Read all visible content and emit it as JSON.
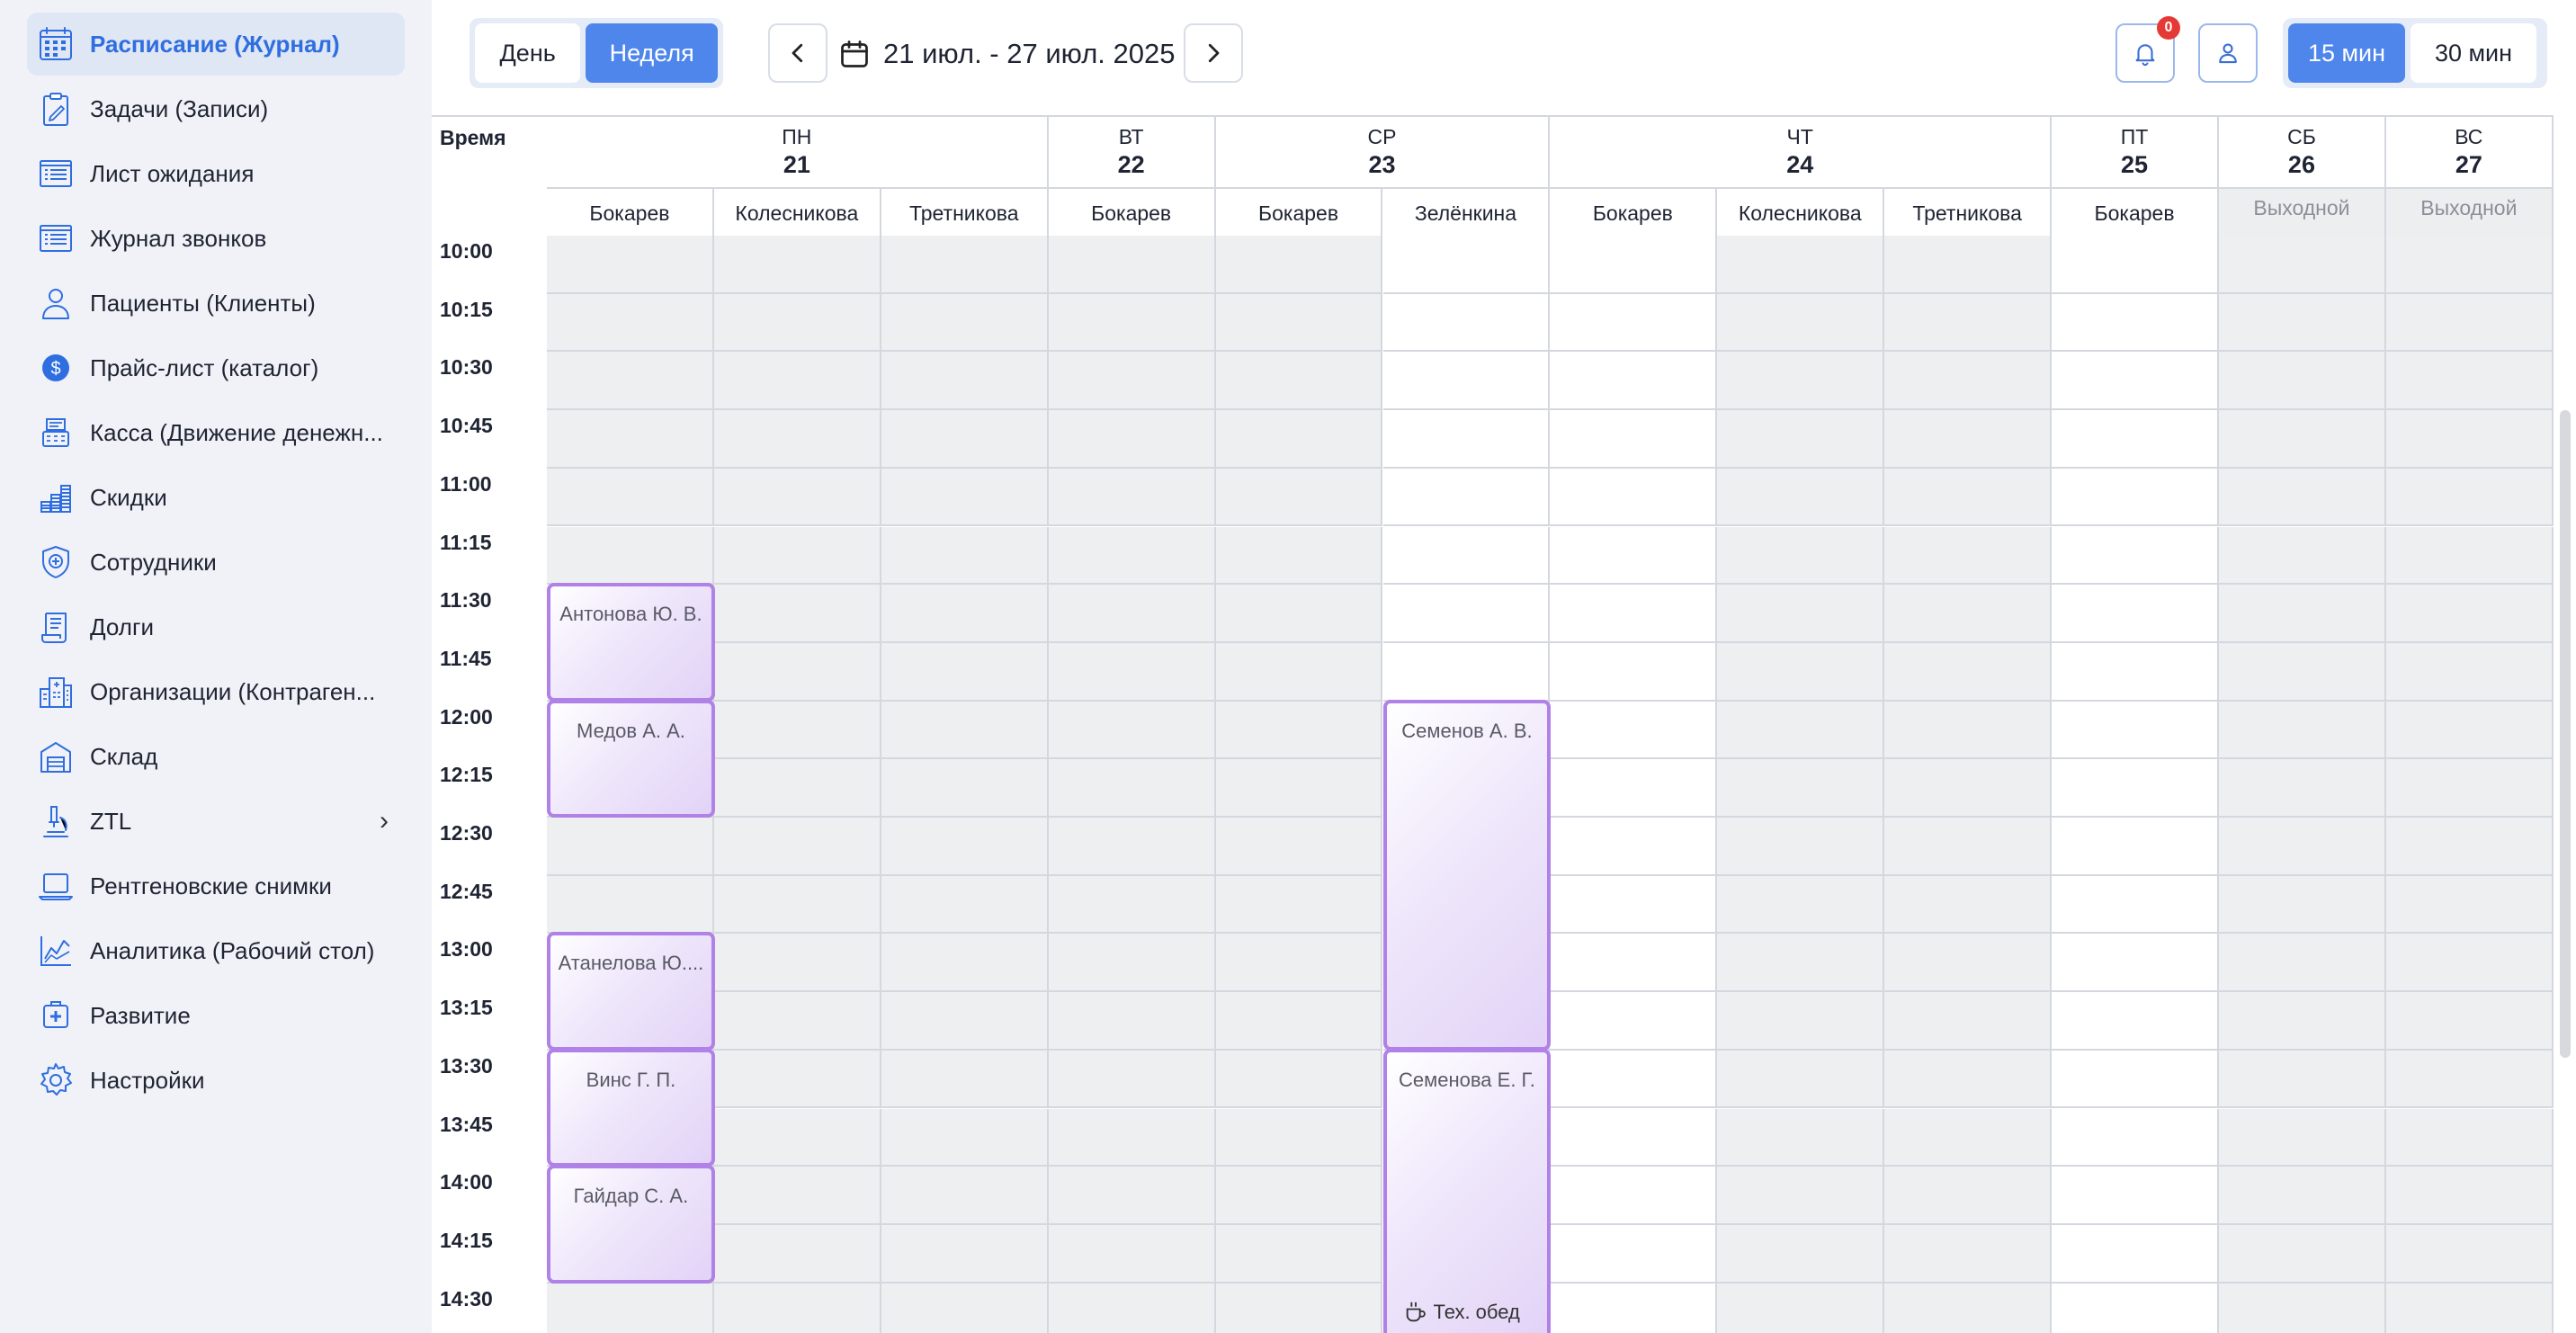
{
  "sidebar": {
    "items": [
      {
        "label": "Расписание (Журнал)",
        "icon": "calendar-grid-icon",
        "active": true
      },
      {
        "label": "Задачи (Записи)",
        "icon": "clipboard-pencil-icon"
      },
      {
        "label": "Лист ожидания",
        "icon": "list-icon"
      },
      {
        "label": "Журнал звонков",
        "icon": "list-icon"
      },
      {
        "label": "Пациенты (Клиенты)",
        "icon": "person-icon"
      },
      {
        "label": "Прайс-лист (каталог)",
        "icon": "dollar-coin-icon"
      },
      {
        "label": "Касса (Движение денежн...",
        "icon": "cash-register-icon"
      },
      {
        "label": "Скидки",
        "icon": "coins-stack-icon"
      },
      {
        "label": "Сотрудники",
        "icon": "shield-plus-icon"
      },
      {
        "label": "Долги",
        "icon": "scroll-icon"
      },
      {
        "label": "Организации (Контраген...",
        "icon": "building-icon"
      },
      {
        "label": "Склад",
        "icon": "warehouse-icon"
      },
      {
        "label": "ZTL",
        "icon": "microscope-icon",
        "has_children": true
      },
      {
        "label": "Рентгеновские снимки",
        "icon": "laptop-icon"
      },
      {
        "label": "Аналитика (Рабочий стол)",
        "icon": "chart-line-icon"
      },
      {
        "label": "Развитие",
        "icon": "medical-plus-icon"
      },
      {
        "label": "Настройки",
        "icon": "gear-icon"
      }
    ]
  },
  "toolbar": {
    "view_day": "День",
    "view_week": "Неделя",
    "date_range": "21 июл. - 27 июл. 2025",
    "notification_count": "0",
    "step_15": "15 мин",
    "step_30": "30 мин",
    "prev_icon": "chevron-left-icon",
    "next_icon": "chevron-right-icon"
  },
  "calendar": {
    "time_header": "Время",
    "days": [
      {
        "dow": "ПН",
        "date": "21",
        "doctors": [
          "Бокарев",
          "Колесникова",
          "Третникова"
        ]
      },
      {
        "dow": "ВТ",
        "date": "22",
        "doctors": [
          "Бокарев"
        ]
      },
      {
        "dow": "СР",
        "date": "23",
        "doctors": [
          "Бокарев",
          "Зелёнкина"
        ]
      },
      {
        "dow": "ЧТ",
        "date": "24",
        "doctors": [
          "Бокарев",
          "Колесникова",
          "Третникова"
        ]
      },
      {
        "dow": "ПТ",
        "date": "25",
        "doctors": [
          "Бокарев"
        ]
      },
      {
        "dow": "СБ",
        "date": "26",
        "doctors": [
          "Выходной"
        ],
        "day_off": true
      },
      {
        "dow": "ВС",
        "date": "27",
        "doctors": [
          "Выходной"
        ],
        "day_off": true
      }
    ],
    "times": [
      "10:00",
      "10:15",
      "10:30",
      "10:45",
      "11:00",
      "11:15",
      "11:30",
      "11:45",
      "12:00",
      "12:15",
      "12:30",
      "12:45",
      "13:00",
      "13:15",
      "13:30",
      "13:45",
      "14:00",
      "14:15",
      "14:30"
    ],
    "column_working": [
      [
        0,
        0,
        0,
        0,
        0,
        0,
        1,
        1,
        1,
        1,
        0,
        0,
        1,
        1,
        1,
        1,
        1,
        1,
        0
      ],
      [
        0,
        0,
        0,
        0,
        0,
        0,
        0,
        0,
        0,
        0,
        0,
        0,
        0,
        0,
        0,
        0,
        0,
        0,
        0
      ],
      [
        0,
        0,
        0,
        0,
        0,
        0,
        0,
        0,
        0,
        0,
        0,
        0,
        0,
        0,
        0,
        0,
        0,
        0,
        0
      ],
      [
        0,
        0,
        0,
        0,
        0,
        0,
        0,
        0,
        0,
        0,
        0,
        0,
        0,
        0,
        0,
        0,
        0,
        0,
        0
      ],
      [
        0,
        0,
        0,
        0,
        0,
        0,
        0,
        0,
        0,
        0,
        0,
        0,
        0,
        0,
        0,
        0,
        0,
        0,
        0
      ],
      [
        1,
        1,
        1,
        1,
        1,
        1,
        1,
        1,
        1,
        1,
        1,
        1,
        1,
        1,
        1,
        1,
        1,
        1,
        1
      ],
      [
        1,
        1,
        1,
        1,
        1,
        1,
        1,
        1,
        1,
        1,
        1,
        1,
        1,
        1,
        1,
        1,
        1,
        1,
        1
      ],
      [
        0,
        0,
        0,
        0,
        0,
        0,
        0,
        0,
        0,
        0,
        0,
        0,
        0,
        0,
        0,
        0,
        0,
        0,
        0
      ],
      [
        0,
        0,
        0,
        0,
        0,
        0,
        0,
        0,
        0,
        0,
        0,
        0,
        0,
        0,
        0,
        0,
        0,
        0,
        0
      ],
      [
        1,
        1,
        1,
        1,
        1,
        1,
        1,
        1,
        1,
        1,
        1,
        1,
        1,
        1,
        1,
        1,
        1,
        1,
        1
      ],
      [
        0,
        0,
        0,
        0,
        0,
        0,
        0,
        0,
        0,
        0,
        0,
        0,
        0,
        0,
        0,
        0,
        0,
        0,
        0
      ],
      [
        0,
        0,
        0,
        0,
        0,
        0,
        0,
        0,
        0,
        0,
        0,
        0,
        0,
        0,
        0,
        0,
        0,
        0,
        0
      ]
    ],
    "appointments": [
      {
        "name": "Антонова Ю. В.",
        "col": 0,
        "start": 6,
        "slots": 2
      },
      {
        "name": "Медов А. А.",
        "col": 0,
        "start": 8,
        "slots": 2
      },
      {
        "name": "Атанелова Ю....",
        "col": 0,
        "start": 12,
        "slots": 2
      },
      {
        "name": "Винс Г. П.",
        "col": 0,
        "start": 14,
        "slots": 2
      },
      {
        "name": "Гайдар С. А.",
        "col": 0,
        "start": 16,
        "slots": 2
      },
      {
        "name": "Семенов А. В.",
        "col": 5,
        "start": 8,
        "slots": 6
      },
      {
        "name": "Семенова Е. Г.",
        "col": 5,
        "start": 14,
        "slots": 5
      }
    ],
    "break": {
      "label": "Тех. обед",
      "icon": "coffee-cup-icon",
      "col": 5,
      "slot": 18
    }
  }
}
